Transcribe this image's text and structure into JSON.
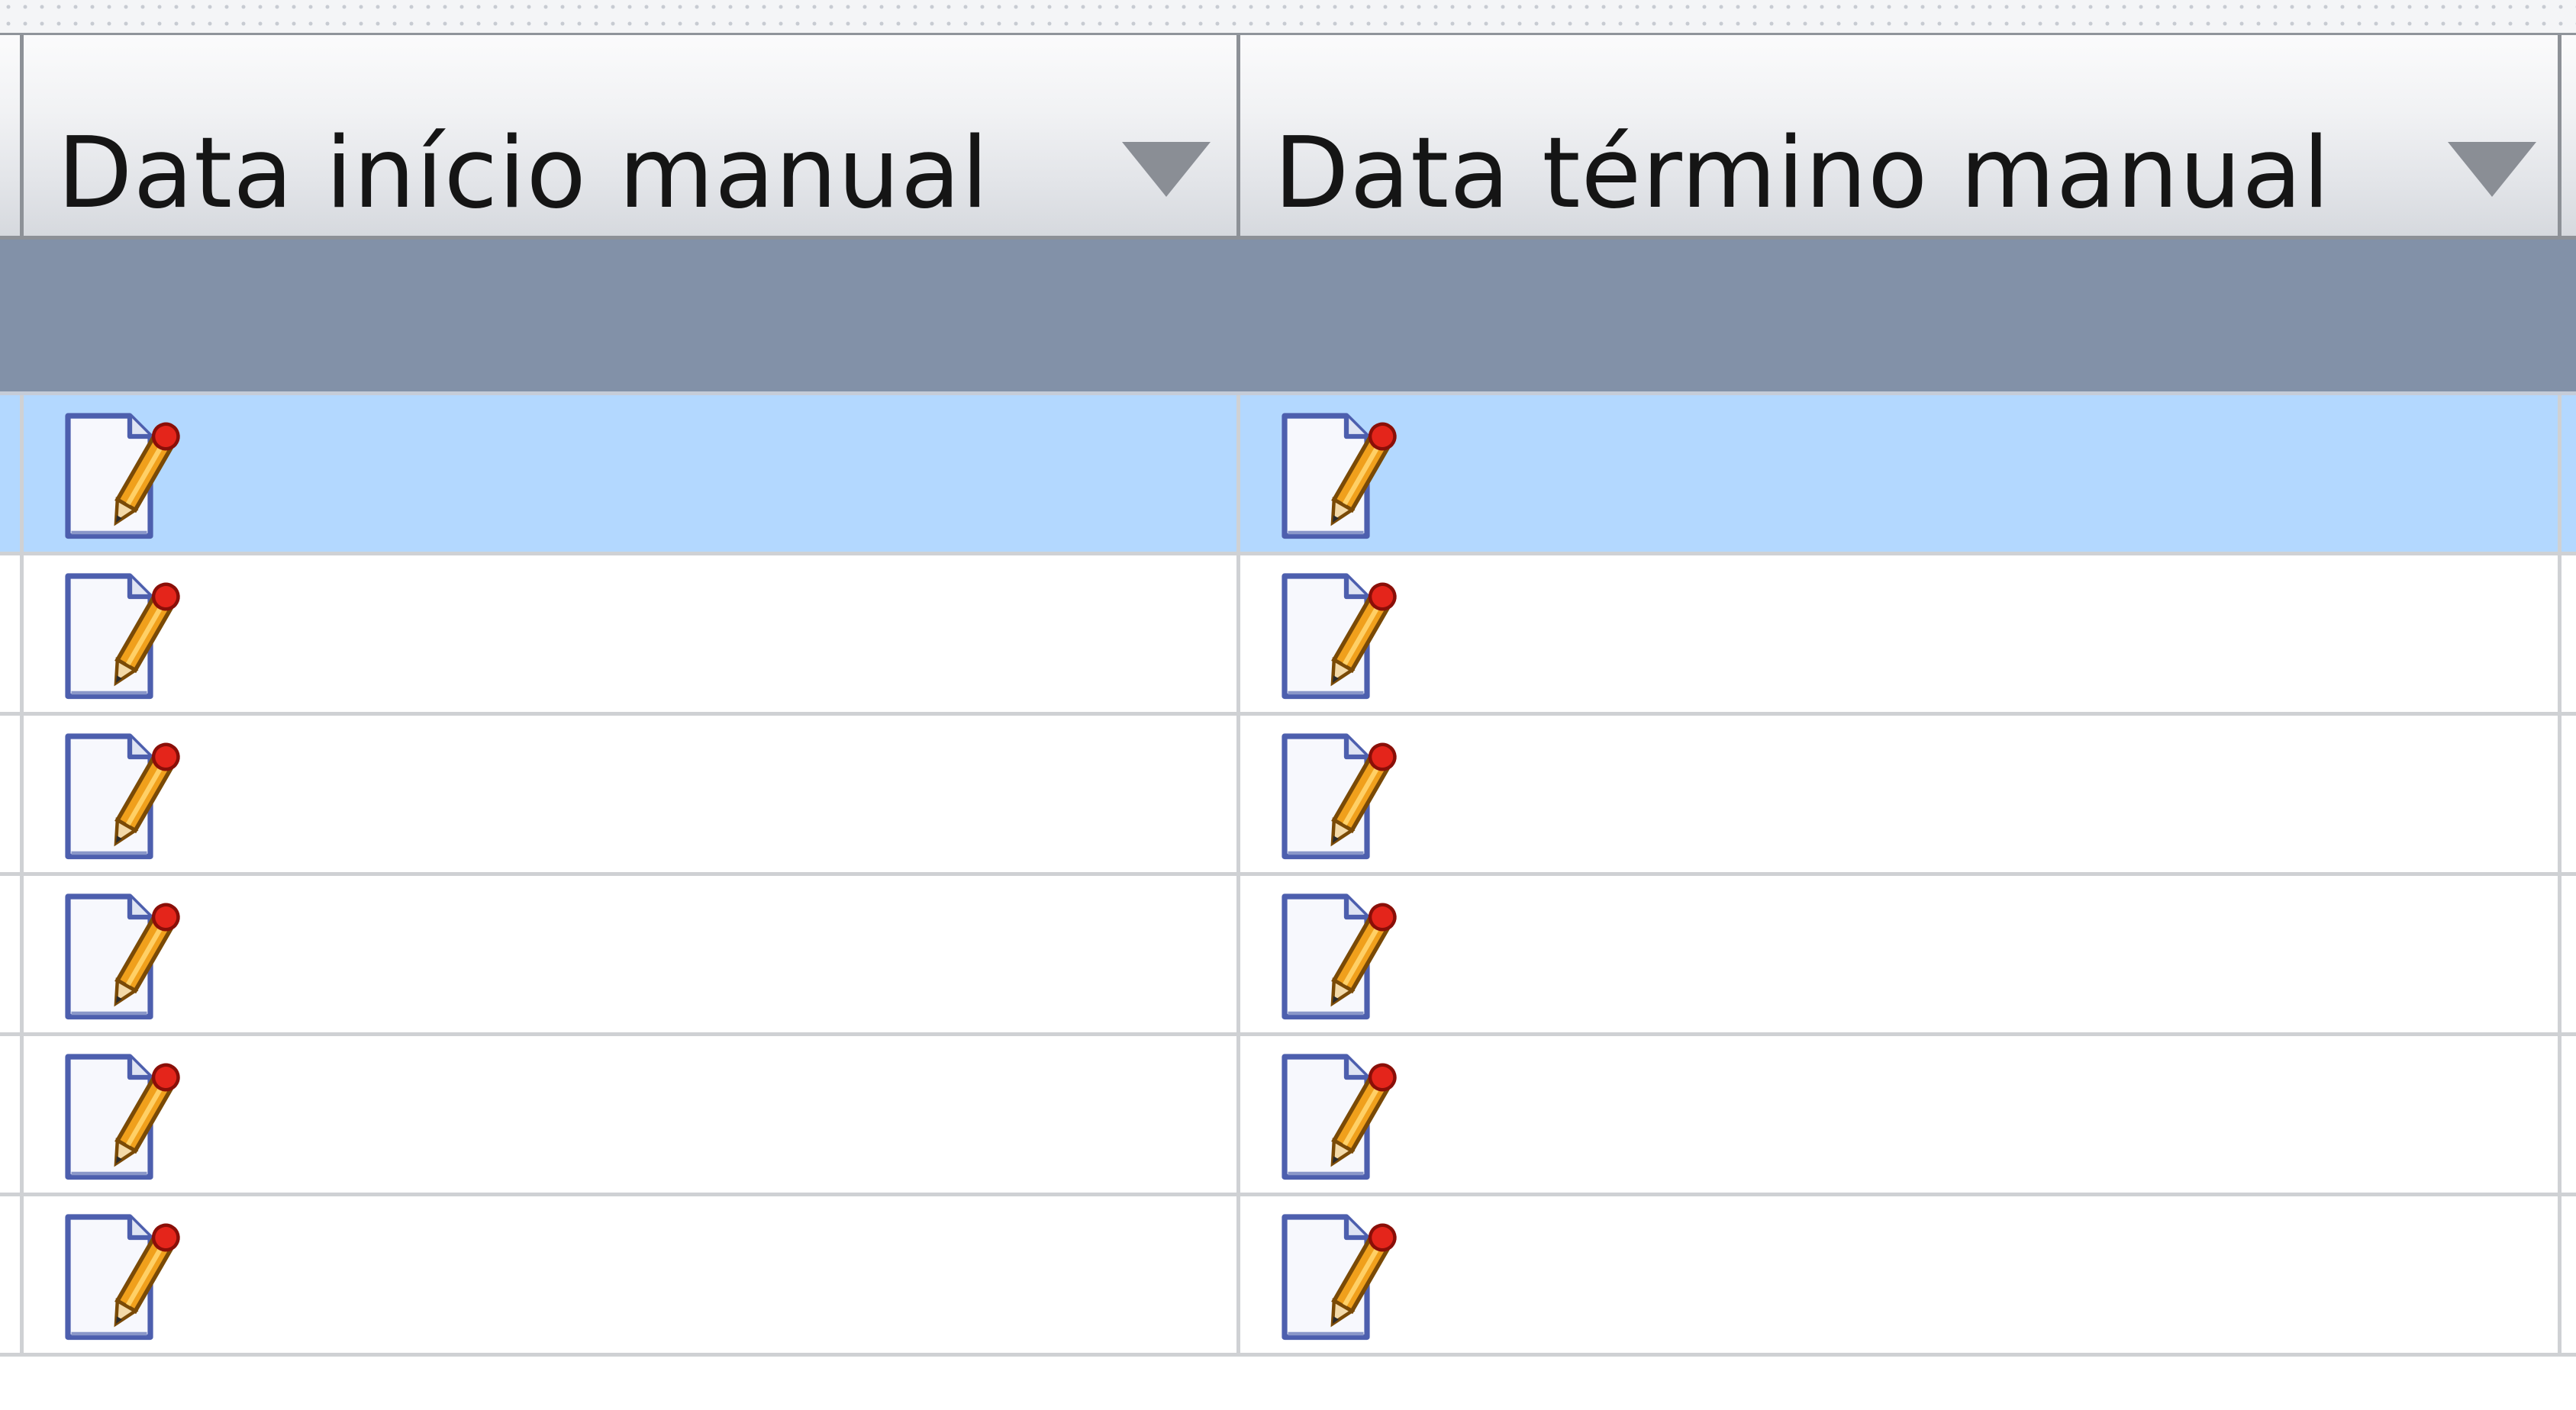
{
  "grid": {
    "columns": [
      {
        "label": "Data início manual"
      },
      {
        "label": "Data término manual"
      }
    ],
    "rows": [
      {
        "selected": true,
        "cells": [
          "edit-document-icon",
          "edit-document-icon"
        ]
      },
      {
        "selected": false,
        "cells": [
          "edit-document-icon",
          "edit-document-icon"
        ]
      },
      {
        "selected": false,
        "cells": [
          "edit-document-icon",
          "edit-document-icon"
        ]
      },
      {
        "selected": false,
        "cells": [
          "edit-document-icon",
          "edit-document-icon"
        ]
      },
      {
        "selected": false,
        "cells": [
          "edit-document-icon",
          "edit-document-icon"
        ]
      },
      {
        "selected": false,
        "cells": [
          "edit-document-icon",
          "edit-document-icon"
        ]
      }
    ]
  },
  "colors": {
    "group_row": "#8291a8",
    "selected_row": "#b3d8ff",
    "header_border": "#8d9197",
    "grid_line": "#cfd1d4"
  }
}
